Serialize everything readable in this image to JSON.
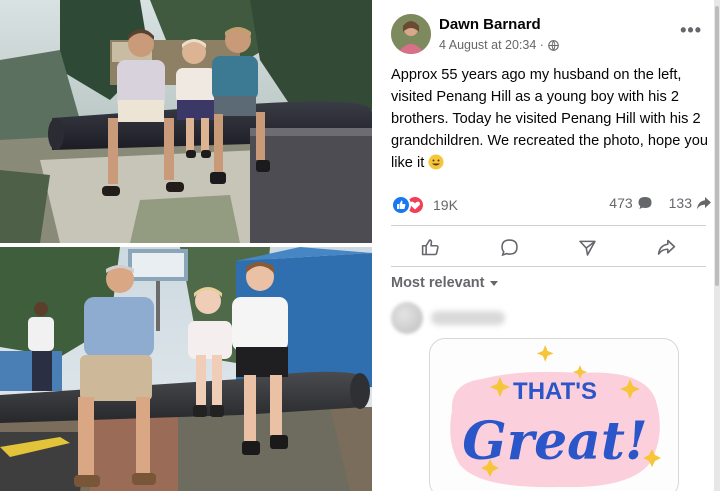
{
  "post": {
    "author": "Dawn Barnard",
    "timestamp": "4 August at 20:34 ·",
    "privacy_icon": "globe-icon",
    "more_label": "•••",
    "text": "Approx 55 years ago my husband on the left, visited Penang Hill as a young boy with his 2 brothers. Today he visited Penang Hill with his 2 grandchildren. We recreated the photo, hope you like it",
    "text_emoji": "smiling-face-emoji"
  },
  "reactions": {
    "types": [
      "like",
      "love"
    ],
    "total": "19K",
    "comments": "473",
    "shares": "133"
  },
  "actions": [
    {
      "name": "like",
      "icon": "thumbs-up-icon"
    },
    {
      "name": "comment",
      "icon": "speech-bubble-icon"
    },
    {
      "name": "send",
      "icon": "send-icon"
    },
    {
      "name": "share",
      "icon": "share-arrow-icon"
    }
  ],
  "comments": {
    "sort_label": "Most relevant"
  },
  "sticker": {
    "line1": "THAT'S",
    "line2": "Great!"
  },
  "colors": {
    "like_blue": "#1877f2",
    "love_red": "#f33e58",
    "sticker_blue": "#2b56c9",
    "sticker_pink": "#fbd0dc",
    "sticker_yellow": "#f7c53a"
  }
}
